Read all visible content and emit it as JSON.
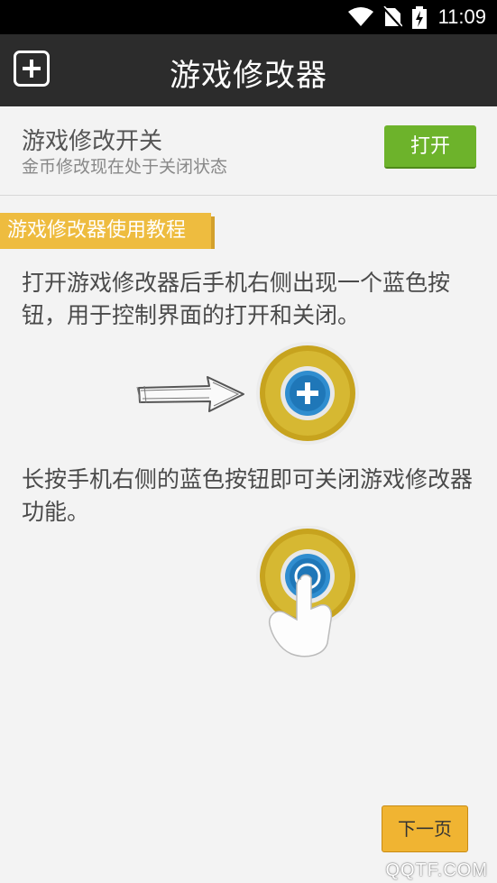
{
  "status_bar": {
    "time": "11:09",
    "icons": [
      "wifi-icon",
      "no-sim-icon",
      "battery-charging-icon"
    ]
  },
  "header": {
    "title": "游戏修改器",
    "add_icon": "plus-square-icon"
  },
  "switch": {
    "title": "游戏修改开关",
    "subtitle": "金币修改现在处于关闭状态",
    "button_label": "打开",
    "button_color": "#6db32b"
  },
  "tutorial": {
    "tag": "游戏修改器使用教程",
    "tag_color": "#eebc3f",
    "step1": "打开游戏修改器后手机右侧出现一个蓝色按钮，用于控制界面的打开和关闭。",
    "step2": "长按手机右侧的蓝色按钮即可关闭游戏修改器功能。"
  },
  "next_button": {
    "label": "下一页",
    "color": "#f0b432"
  },
  "watermark": "QQTF.COM"
}
